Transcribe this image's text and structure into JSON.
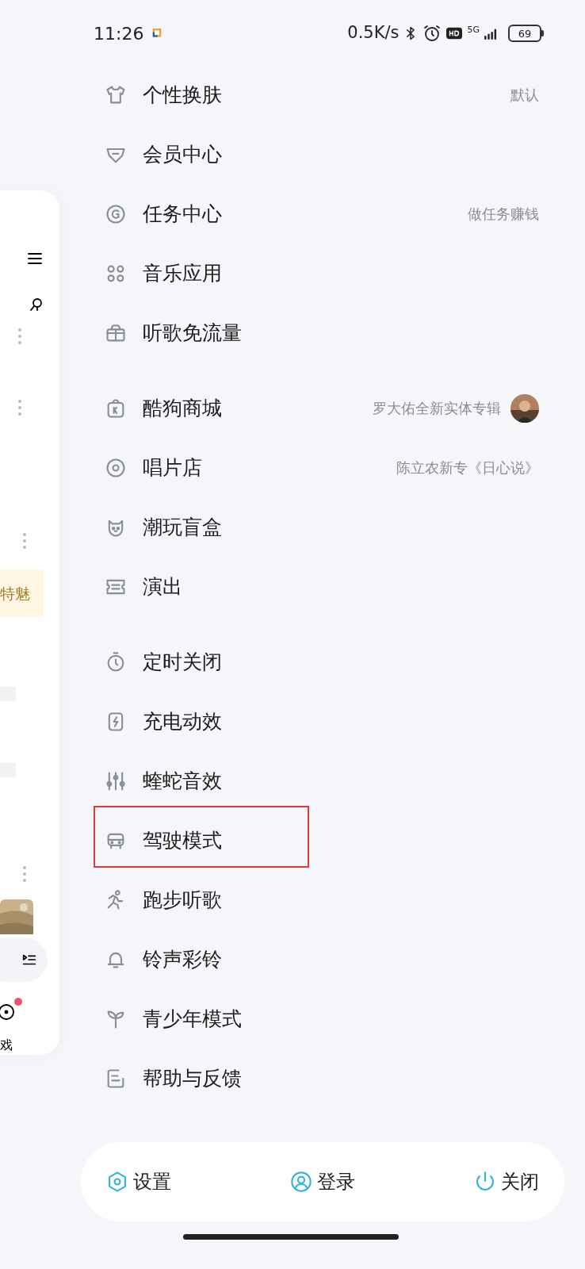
{
  "status_bar": {
    "time": "11:26",
    "speed": "0.5K/s",
    "network": "5G",
    "battery": "69"
  },
  "background_page": {
    "banner_text": "特魅",
    "tab_label": "戏",
    "notification_dot": true
  },
  "menu_groups": [
    {
      "items": [
        {
          "label": "个性换肤",
          "note": "默认"
        },
        {
          "label": "会员中心"
        },
        {
          "label": "任务中心",
          "note": "做任务赚钱"
        },
        {
          "label": "音乐应用"
        },
        {
          "label": "听歌免流量"
        }
      ]
    },
    {
      "items": [
        {
          "label": "酷狗商城",
          "note": "罗大佑全新实体专辑",
          "thumbnail": true
        },
        {
          "label": "唱片店",
          "note": "陈立农新专《日心说》"
        },
        {
          "label": "潮玩盲盒"
        },
        {
          "label": "演出"
        }
      ]
    },
    {
      "items": [
        {
          "label": "定时关闭"
        },
        {
          "label": "充电动效"
        },
        {
          "label": "蝰蛇音效"
        },
        {
          "label": "驾驶模式",
          "highlighted": true
        },
        {
          "label": "跑步听歌"
        },
        {
          "label": "铃声彩铃"
        },
        {
          "label": "青少年模式"
        },
        {
          "label": "帮助与反馈"
        }
      ]
    }
  ],
  "bottom_bar": [
    {
      "label": "设置"
    },
    {
      "label": "登录"
    },
    {
      "label": "关闭"
    }
  ]
}
